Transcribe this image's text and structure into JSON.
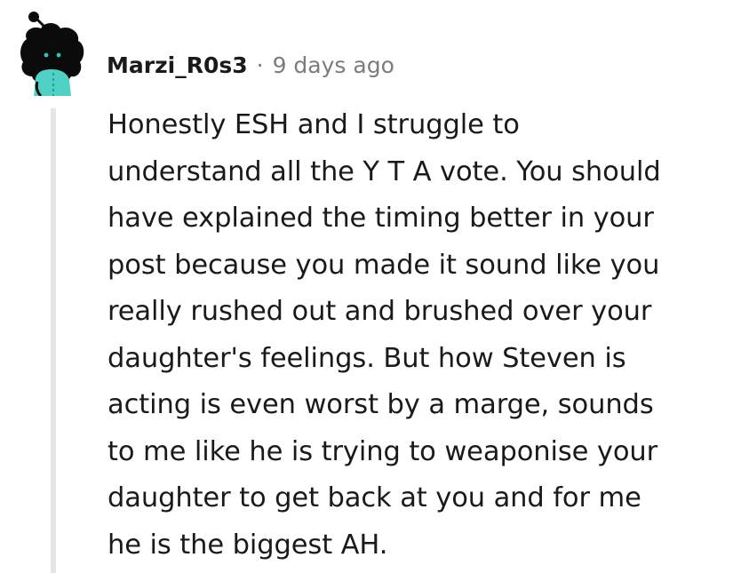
{
  "comment": {
    "username": "Marzi_R0s3",
    "separator": "·",
    "timestamp": "9 days ago",
    "body_lines": [
      "Honestly ESH and I struggle to",
      "understand all the Y T A vote. You should",
      "have explained the timing better in your",
      "post because you made it sound like you",
      "really rushed out and brushed over your",
      "daughter's feelings. But how Steven is",
      "acting is even worst by a marge, sounds",
      "to me like he is trying to weaponise your",
      "daughter to get back at you and for me",
      "he is the biggest AH."
    ],
    "avatar_icon": "snoo-avatar-icon"
  },
  "colors": {
    "text": "#1a1a1b",
    "meta": "#7c7c7c",
    "thread_line": "#e5e5e5",
    "avatar_body": "#0b0b0b",
    "avatar_shirt": "#4fd1c5",
    "avatar_eyes": "#2ec4b6"
  }
}
